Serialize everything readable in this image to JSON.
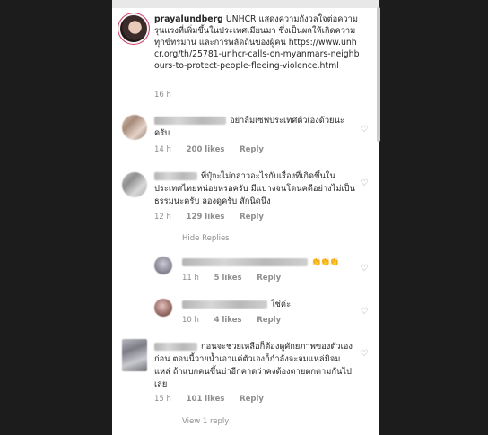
{
  "post": {
    "username": "prayalundberg",
    "caption": "UNHCR แสดงความกังวลใจต่อความรุนแรงที่เพิ่มขึ้นในประเทศเมียนมา ซึ่งเป็นผลให้เกิดความทุกข์ทรมาน และการพลัดถิ่นของผู้คน https://www.unhcr.org/th/25781-unhcr-calls-on-myanmars-neighbours-to-protect-people-fleeing-violence.html",
    "time": "16 h"
  },
  "comments": [
    {
      "text": "อย่าลืมเซฟประเทศตัวเองด้วยนะครับ",
      "time": "14 h",
      "likes": "200 likes",
      "reply": "Reply"
    },
    {
      "text": "ที่ปุ๋จะไม่กล่าวอะไรกับเรื่องที่เกิดขึ้นในประเทศไทยหน่อยหรอครับ มีแบางจนโดนคดีอย่างไม่เป็นธรรมนะครับ ลองดูครับ สักนิดนึง",
      "time": "12 h",
      "likes": "129 likes",
      "reply": "Reply"
    },
    {
      "text": "ก่อนจะช่วยเหลือก็ต้องดูศักยภาพของตัวเองก่อน ตอนนี้วายน้ำเอาแค่ตัวเองก็กำลังจะจมแหล่มิจมแหล่ ถ้าแบกคนขึ้นบ่าอีกคาดว่าคงต้องตายตกตามกันไปเลย",
      "time": "15 h",
      "likes": "101 likes",
      "reply": "Reply"
    }
  ],
  "replies_toggle": "Hide Replies",
  "replies": [
    {
      "text": "👏👏👏",
      "time": "11 h",
      "likes": "5 likes",
      "reply": "Reply"
    },
    {
      "text": "ใช่ค่ะ",
      "time": "10 h",
      "likes": "4 likes",
      "reply": "Reply"
    }
  ],
  "view_replies": "View 1 reply",
  "icons": {
    "like": "heart-outline-icon"
  }
}
